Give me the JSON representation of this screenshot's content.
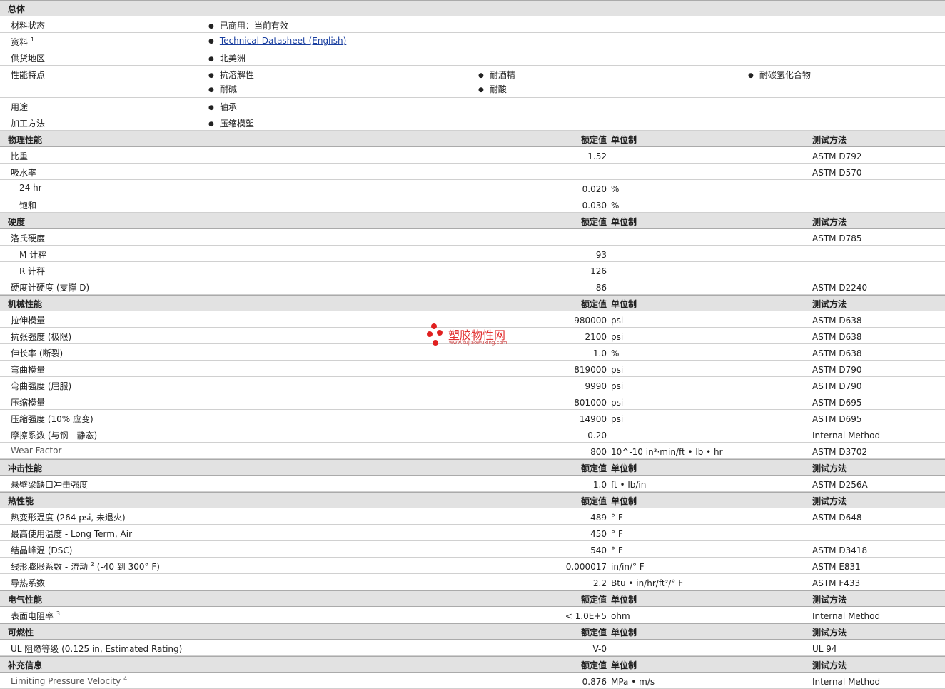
{
  "sections": {
    "general": "总体",
    "physical": "物理性能",
    "hardness": "硬度",
    "mechanical": "机械性能",
    "impact": "冲击性能",
    "thermal": "热性能",
    "electrical": "电气性能",
    "flammability": "可燃性",
    "supplemental": "补充信息"
  },
  "headers": {
    "value": "额定值",
    "unit": "单位制",
    "method": "测试方法"
  },
  "general": {
    "status_label": "材料状态",
    "status": "已商用：当前有效",
    "docs_label": "资料",
    "docs_sup": "1",
    "datasheet_link": "Technical Datasheet (English)",
    "region_label": "供货地区",
    "region": "北美洲",
    "features_label": "性能特点",
    "features": [
      "抗溶解性",
      "耐酒精",
      "耐碳氢化合物",
      "耐碱",
      "耐酸"
    ],
    "uses_label": "用途",
    "uses": "轴承",
    "processing_label": "加工方法",
    "processing": "压缩模塑"
  },
  "physical": [
    {
      "label": "比重",
      "value": "1.52",
      "unit": "",
      "method": "ASTM D792"
    },
    {
      "label": "吸水率",
      "value": "",
      "unit": "",
      "method": "ASTM D570"
    },
    {
      "label": "24 hr",
      "value": "0.020",
      "unit": "%",
      "method": ""
    },
    {
      "label": "饱和",
      "value": "0.030",
      "unit": "%",
      "method": ""
    }
  ],
  "hardness": [
    {
      "label": "洛氏硬度",
      "value": "",
      "unit": "",
      "method": "ASTM D785"
    },
    {
      "label": "M 计秤",
      "value": "93",
      "unit": "",
      "method": ""
    },
    {
      "label": "R 计秤",
      "value": "126",
      "unit": "",
      "method": ""
    },
    {
      "label": "硬度计硬度 (支撑  D)",
      "value": "86",
      "unit": "",
      "method": "ASTM D2240"
    }
  ],
  "mechanical": [
    {
      "label": "拉伸模量",
      "value": "980000",
      "unit": "psi",
      "method": "ASTM D638"
    },
    {
      "label": "抗张强度 (极限)",
      "value": "2100",
      "unit": "psi",
      "method": "ASTM D638"
    },
    {
      "label": "伸长率 (断裂)",
      "value": "1.0",
      "unit": "%",
      "method": "ASTM D638"
    },
    {
      "label": "弯曲模量",
      "value": "819000",
      "unit": "psi",
      "method": "ASTM D790"
    },
    {
      "label": "弯曲强度 (屈服)",
      "value": "9990",
      "unit": "psi",
      "method": "ASTM D790"
    },
    {
      "label": "压缩模量",
      "value": "801000",
      "unit": "psi",
      "method": "ASTM D695"
    },
    {
      "label": "压缩强度 (10% 应变)",
      "value": "14900",
      "unit": "psi",
      "method": "ASTM D695"
    },
    {
      "label": "摩擦系数 (与钢  - 静态)",
      "value": "0.20",
      "unit": "",
      "method": "Internal Method"
    },
    {
      "label": "Wear Factor",
      "value": "800",
      "unit": "10^-10 in³·min/ft • lb • hr",
      "method": "ASTM D3702"
    }
  ],
  "impact": [
    {
      "label": "悬壁梁缺口冲击强度",
      "value": "1.0",
      "unit": "ft • lb/in",
      "method": "ASTM D256A"
    }
  ],
  "thermal": [
    {
      "label": "热变形温度 (264 psi, 未退火)",
      "value": "489",
      "unit": "°  F",
      "method": "ASTM D648"
    },
    {
      "label": "最高使用温度  - Long Term, Air",
      "value": "450",
      "unit": "°  F",
      "method": ""
    },
    {
      "label": "结晶峰温 (DSC)",
      "value": "540",
      "unit": "°  F",
      "method": "ASTM D3418"
    },
    {
      "label": "线形膨胀系数  - 流动",
      "sup": "2",
      "label2": " (-40 到  300°  F)",
      "value": "0.000017",
      "unit": "in/in/°  F",
      "method": "ASTM E831"
    },
    {
      "label": "导热系数",
      "value": "2.2",
      "unit": "Btu • in/hr/ft²/°  F",
      "method": "ASTM F433"
    }
  ],
  "electrical": [
    {
      "label": "表面电阻率",
      "sup": "3",
      "value": "< 1.0E+5",
      "unit": "ohm",
      "method": "Internal Method"
    }
  ],
  "flammability": [
    {
      "label": "UL 阻燃等级 (0.125 in, Estimated Rating)",
      "value": "V-0",
      "unit": "",
      "method": "UL 94"
    }
  ],
  "supplemental": [
    {
      "label": "Limiting Pressure Velocity",
      "sup": "4",
      "value": "0.876",
      "unit": "MPa • m/s",
      "method": "Internal Method"
    }
  ],
  "watermark": {
    "name": "塑胶物性网",
    "url": "www.sujiaowuxing.com",
    "dot_color": "#e02020"
  }
}
